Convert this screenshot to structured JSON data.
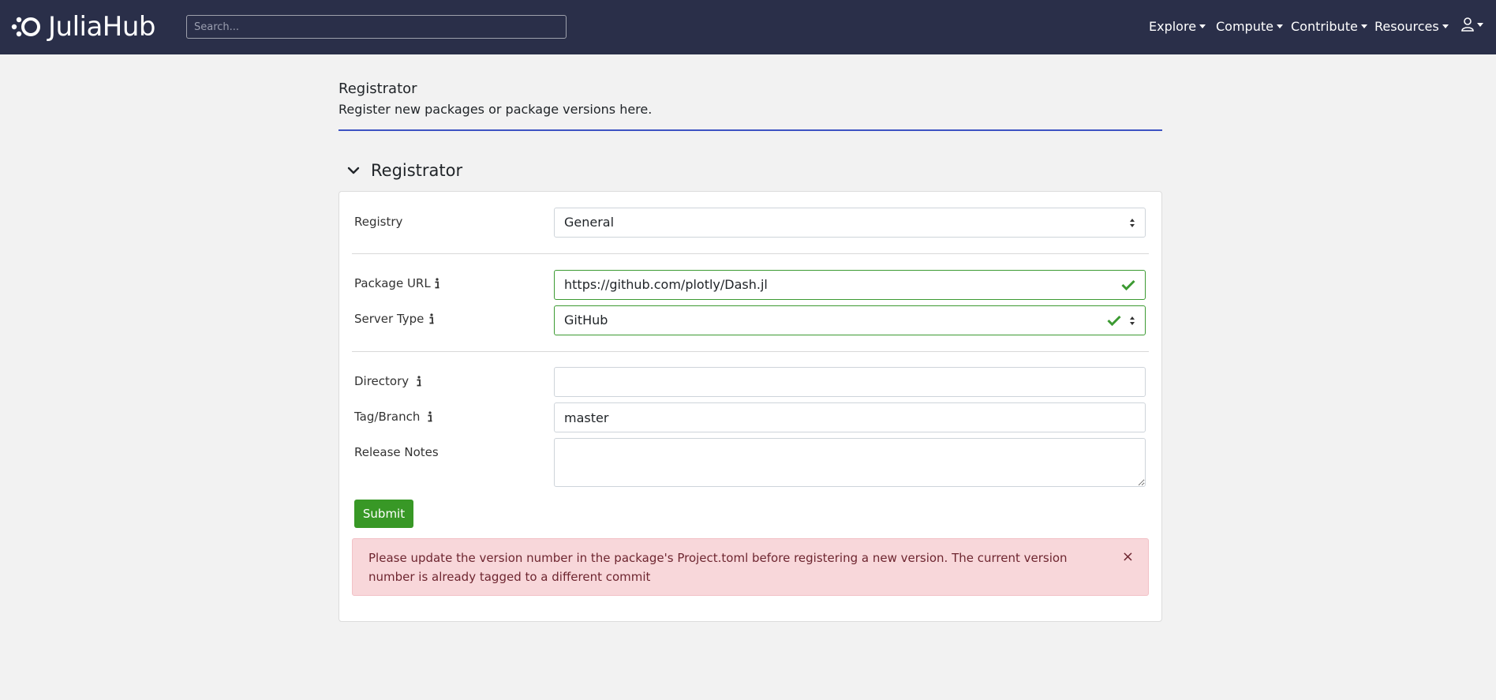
{
  "navbar": {
    "brand": "JuliaHub",
    "search_placeholder": "Search...",
    "menu": [
      {
        "label": "Explore"
      },
      {
        "label": "Compute"
      },
      {
        "label": "Contribute"
      },
      {
        "label": "Resources"
      }
    ],
    "user_icon": "user-icon"
  },
  "page": {
    "title": "Registrator",
    "description": "Register new packages or package versions here."
  },
  "section": {
    "title": "Registrator",
    "toggle_icon": "chevron-down-icon"
  },
  "form": {
    "registry": {
      "label": "Registry",
      "value": "General"
    },
    "package_url": {
      "label": "Package URL",
      "value": "https://github.com/plotly/Dash.jl"
    },
    "server_type": {
      "label": "Server Type",
      "value": "GitHub"
    },
    "directory": {
      "label": "Directory",
      "value": ""
    },
    "tag_branch": {
      "label": "Tag/Branch",
      "value": "master"
    },
    "release_notes": {
      "label": "Release Notes",
      "value": ""
    },
    "submit_label": "Submit"
  },
  "alert": {
    "message": "Please update the version number in the package's Project.toml before registering a new version. The current version number is already tagged to a different commit",
    "close": "×"
  },
  "colors": {
    "navbar": "#2a2f49",
    "accent_line": "#3d53c3",
    "success": "#389826",
    "alert_bg": "#f8d7da",
    "alert_text": "#6e2630"
  }
}
